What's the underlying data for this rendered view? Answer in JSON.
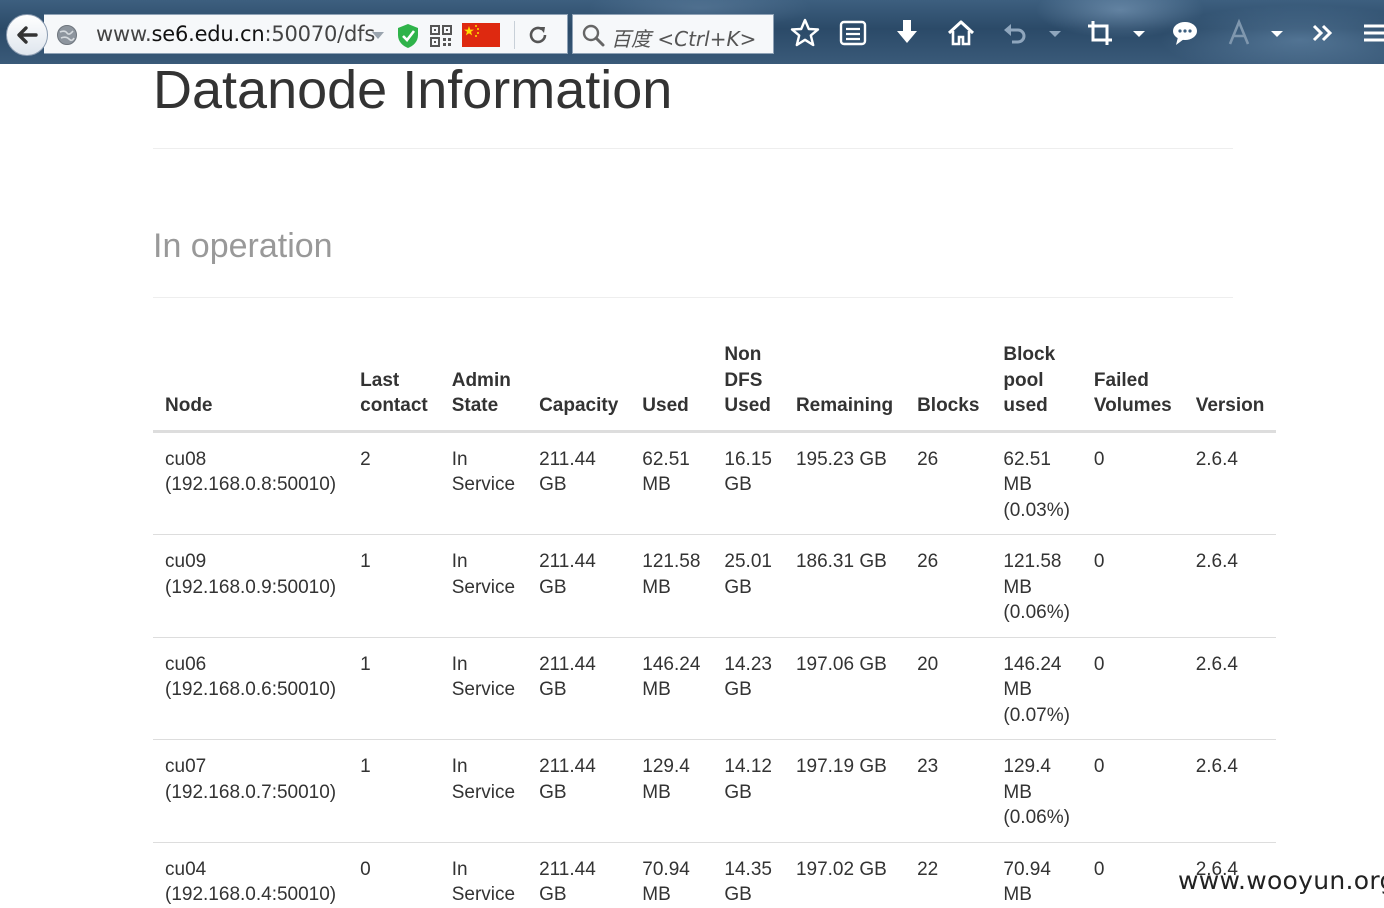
{
  "browser": {
    "url_prefix": "www.",
    "url_host": "se6.edu.cn",
    "url_rest": ":50070/dfs",
    "search_placeholder": "百度 <Ctrl+K>"
  },
  "page": {
    "title": "Datanode Information",
    "section_title": "In operation"
  },
  "table": {
    "headers": {
      "node": "Node",
      "last_contact": [
        "Last",
        "contact"
      ],
      "admin_state": [
        "Admin",
        "State"
      ],
      "capacity": "Capacity",
      "used": "Used",
      "non_dfs_used": [
        "Non",
        "DFS",
        "Used"
      ],
      "remaining": "Remaining",
      "blocks": "Blocks",
      "block_pool_used": [
        "Block",
        "pool",
        "used"
      ],
      "failed_volumes": [
        "Failed",
        "Volumes"
      ],
      "version": "Version"
    },
    "rows": [
      {
        "node": [
          "cu08",
          "(192.168.0.8:50010)"
        ],
        "last_contact": "2",
        "admin_state": [
          "In",
          "Service"
        ],
        "capacity": [
          "211.44",
          "GB"
        ],
        "used": [
          "62.51",
          "MB"
        ],
        "non_dfs_used": [
          "16.15",
          "GB"
        ],
        "remaining": "195.23 GB",
        "blocks": "26",
        "block_pool_used": [
          "62.51",
          "MB",
          "(0.03%)"
        ],
        "failed_volumes": "0",
        "version": "2.6.4"
      },
      {
        "node": [
          "cu09",
          "(192.168.0.9:50010)"
        ],
        "last_contact": "1",
        "admin_state": [
          "In",
          "Service"
        ],
        "capacity": [
          "211.44",
          "GB"
        ],
        "used": [
          "121.58",
          "MB"
        ],
        "non_dfs_used": [
          "25.01",
          "GB"
        ],
        "remaining": "186.31 GB",
        "blocks": "26",
        "block_pool_used": [
          "121.58",
          "MB",
          "(0.06%)"
        ],
        "failed_volumes": "0",
        "version": "2.6.4"
      },
      {
        "node": [
          "cu06",
          "(192.168.0.6:50010)"
        ],
        "last_contact": "1",
        "admin_state": [
          "In",
          "Service"
        ],
        "capacity": [
          "211.44",
          "GB"
        ],
        "used": [
          "146.24",
          "MB"
        ],
        "non_dfs_used": [
          "14.23",
          "GB"
        ],
        "remaining": "197.06 GB",
        "blocks": "20",
        "block_pool_used": [
          "146.24",
          "MB",
          "(0.07%)"
        ],
        "failed_volumes": "0",
        "version": "2.6.4"
      },
      {
        "node": [
          "cu07",
          "(192.168.0.7:50010)"
        ],
        "last_contact": "1",
        "admin_state": [
          "In",
          "Service"
        ],
        "capacity": [
          "211.44",
          "GB"
        ],
        "used": [
          "129.4",
          "MB"
        ],
        "non_dfs_used": [
          "14.12",
          "GB"
        ],
        "remaining": "197.19 GB",
        "blocks": "23",
        "block_pool_used": [
          "129.4",
          "MB",
          "(0.06%)"
        ],
        "failed_volumes": "0",
        "version": "2.6.4"
      },
      {
        "node": [
          "cu04",
          "(192.168.0.4:50010)"
        ],
        "last_contact": "0",
        "admin_state": [
          "In",
          "Service"
        ],
        "capacity": [
          "211.44",
          "GB"
        ],
        "used": [
          "70.94",
          "MB"
        ],
        "non_dfs_used": [
          "14.35",
          "GB"
        ],
        "remaining": "197.02 GB",
        "blocks": "22",
        "block_pool_used": [
          "70.94",
          "MB"
        ],
        "failed_volumes": "0",
        "version": "2.6.4"
      }
    ]
  },
  "watermark": "www.wooyun.org",
  "icons": {
    "back": "back-arrow-icon",
    "globe": "globe-icon",
    "shield": "shield-check-icon",
    "qr": "qr-code-icon",
    "flag": "china-flag-icon",
    "reload": "reload-icon",
    "search": "search-icon",
    "bookmark": "star-icon",
    "reading_list": "list-icon",
    "download": "download-arrow-icon",
    "home": "home-icon",
    "undo": "undo-icon",
    "crop": "crop-icon",
    "chat": "chat-bubble-icon",
    "overflow": "chevron-double-right-icon",
    "menu": "hamburger-menu-icon"
  },
  "colors": {
    "flag_red": "#de2910",
    "shield_green": "#2fb34a",
    "section_gray": "#999999"
  }
}
